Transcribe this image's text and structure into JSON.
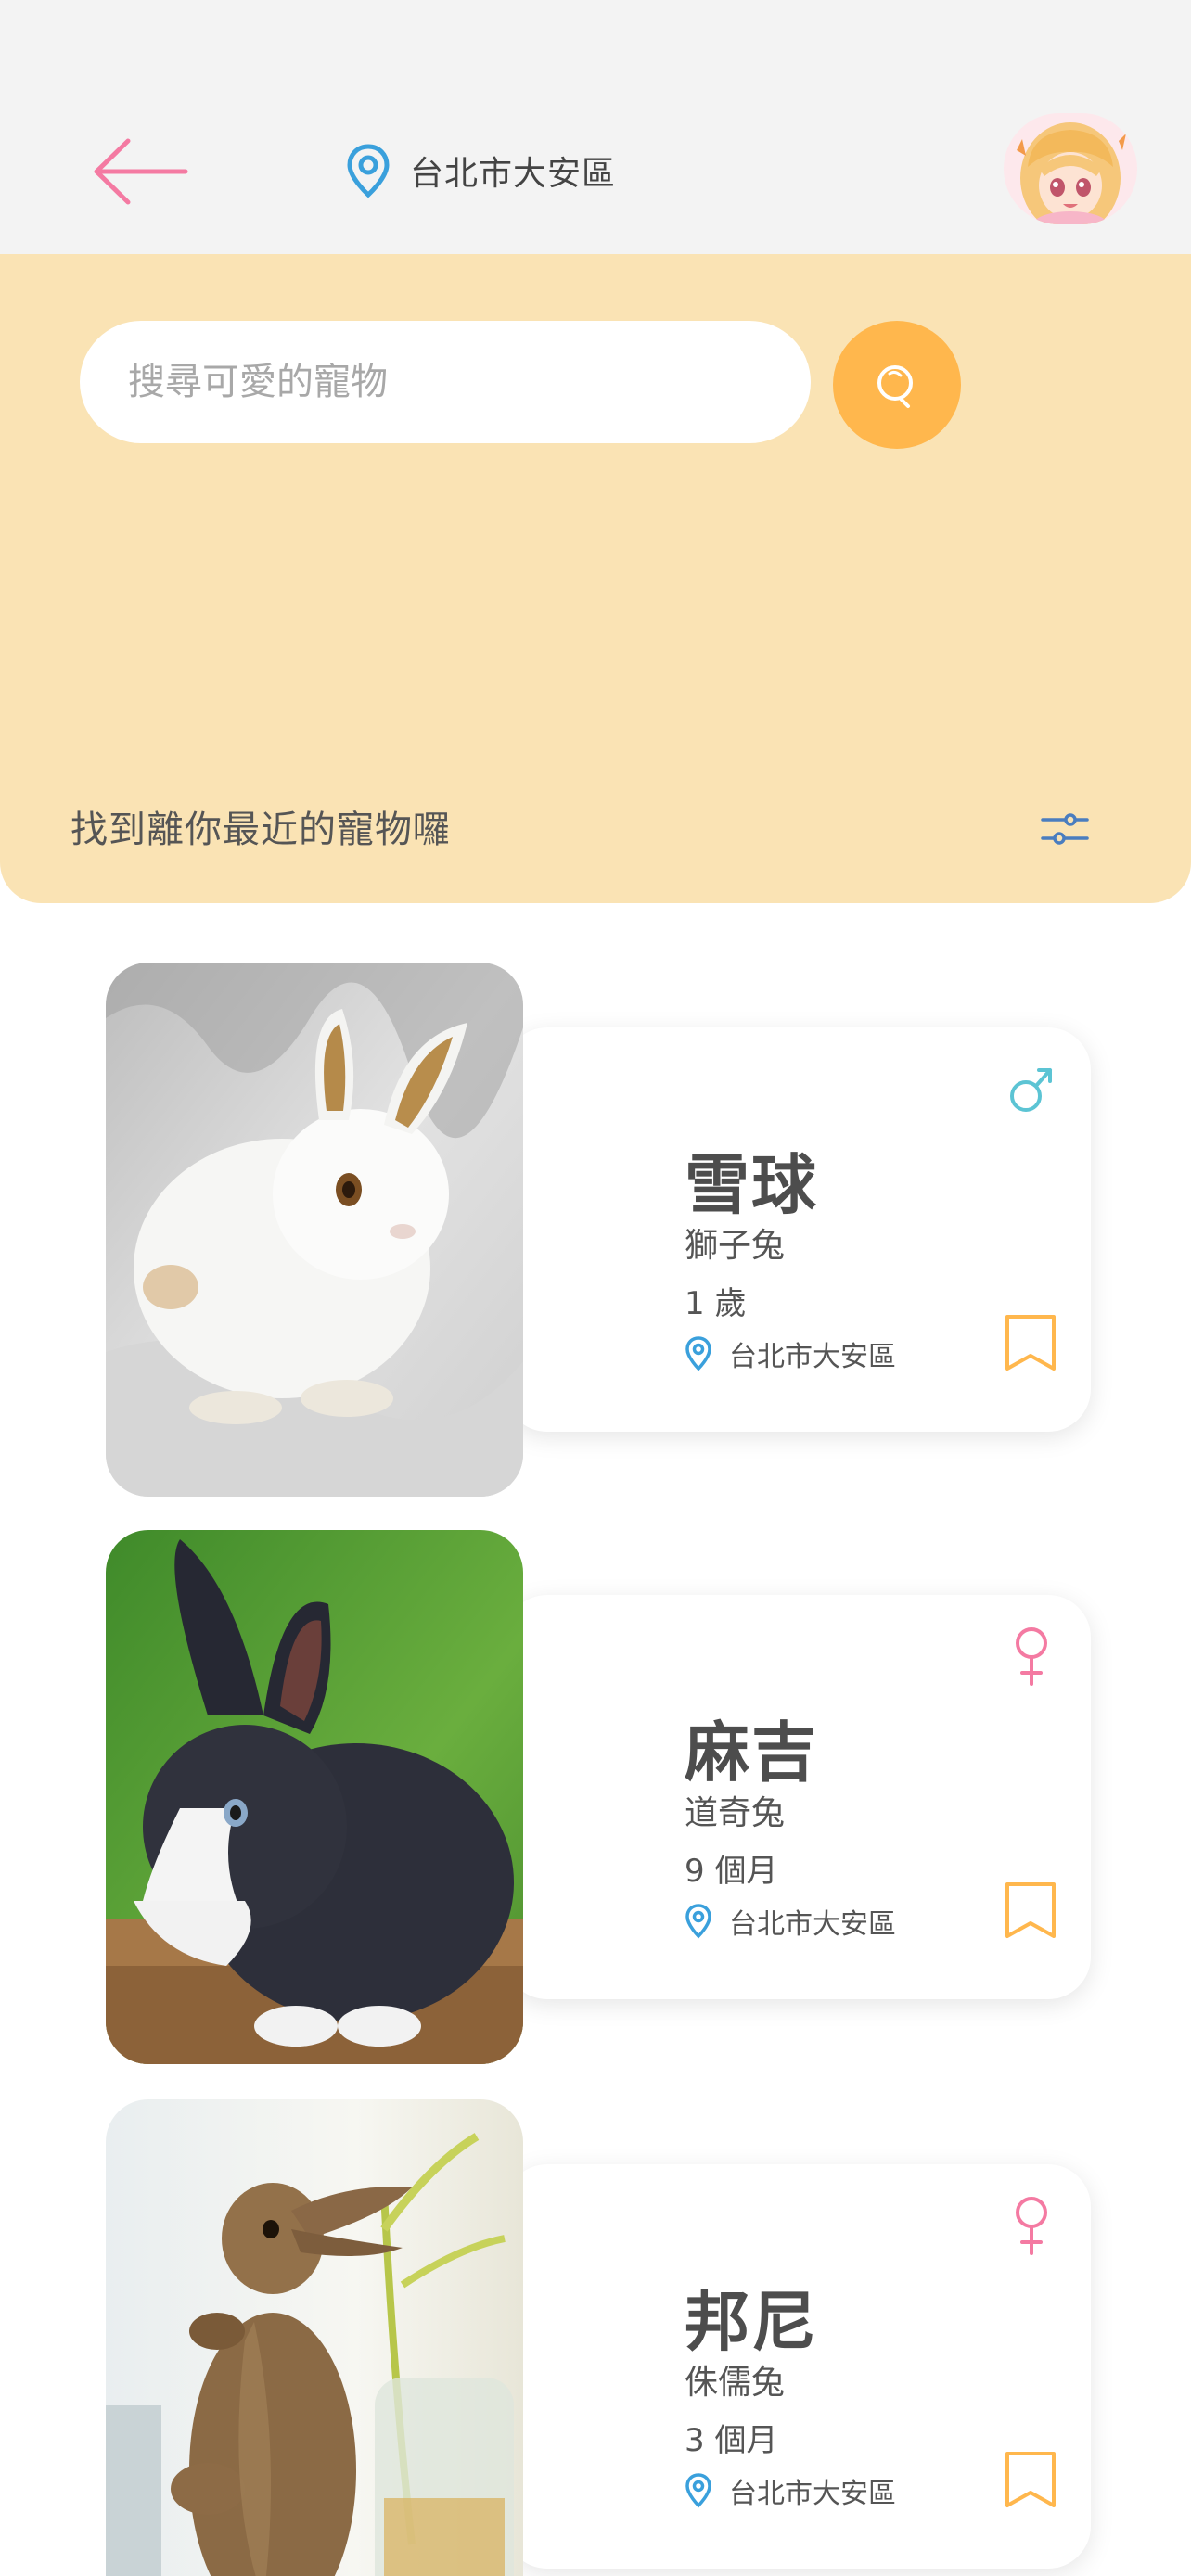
{
  "header": {
    "back_icon": "arrow-left-icon",
    "location_icon": "map-pin-icon",
    "location": "台北市大安區",
    "avatar_icon": "user-avatar"
  },
  "search": {
    "placeholder": "搜尋可愛的寵物",
    "button_icon": "search-icon",
    "subtitle": "找到離你最近的寵物囉",
    "filter_icon": "sliders-icon"
  },
  "colors": {
    "accent_pink": "#f47aa2",
    "accent_orange": "#ffb74d",
    "panel_bg": "#fae3b4",
    "pin_blue": "#3aa0dc",
    "male_teal": "#5cc4d4"
  },
  "pets": [
    {
      "name": "雪球",
      "breed": "獅子兔",
      "age": "1 歲",
      "location": "台北市大安區",
      "gender": "male",
      "photo": "white-lionhead-rabbit"
    },
    {
      "name": "麻吉",
      "breed": "道奇兔",
      "age": "9 個月",
      "location": "台北市大安區",
      "gender": "female",
      "photo": "black-white-dutch-rabbit"
    },
    {
      "name": "邦尼",
      "breed": "侏儒兔",
      "age": "3 個月",
      "location": "台北市大安區",
      "gender": "female",
      "photo": "brown-dwarf-rabbit"
    }
  ]
}
